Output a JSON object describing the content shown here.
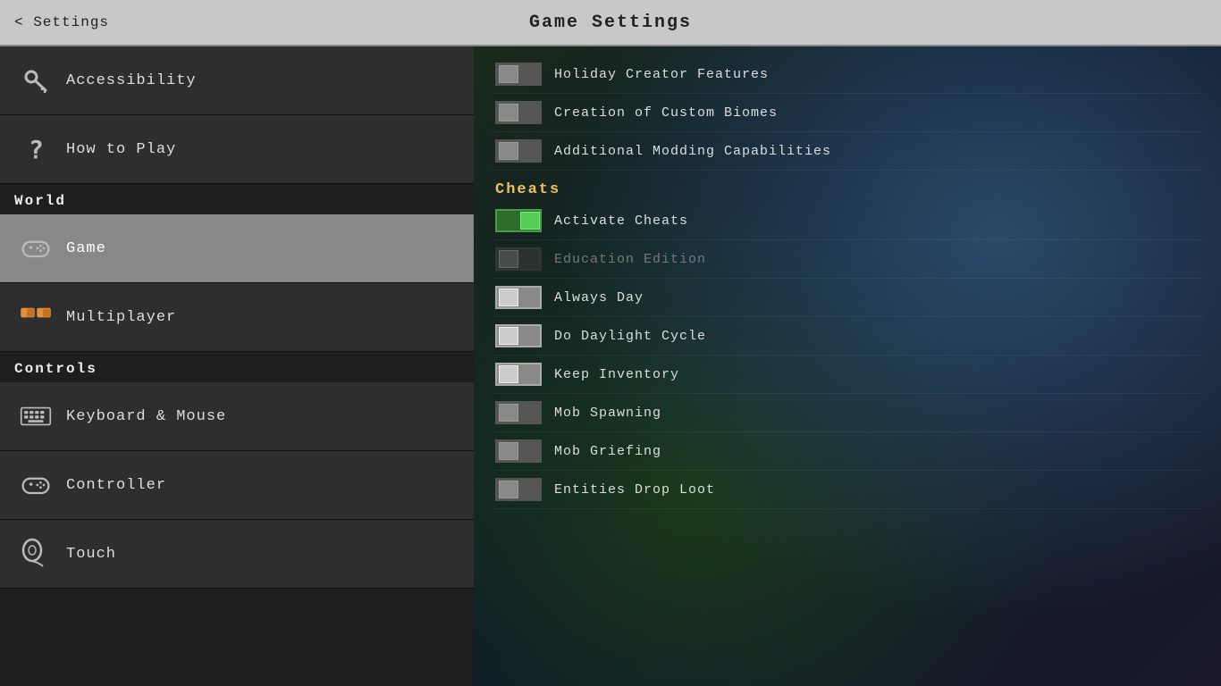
{
  "header": {
    "back_label": "< Settings",
    "title": "Game Settings"
  },
  "sidebar": {
    "items_top": [
      {
        "id": "accessibility",
        "label": "Accessibility",
        "icon": "key",
        "active": false
      },
      {
        "id": "how-to-play",
        "label": "How to Play",
        "icon": "question",
        "active": false
      }
    ],
    "section_world": "World",
    "items_world": [
      {
        "id": "game",
        "label": "Game",
        "icon": "controller",
        "active": true
      },
      {
        "id": "multiplayer",
        "label": "Multiplayer",
        "icon": "players",
        "active": false
      }
    ],
    "section_controls": "Controls",
    "items_controls": [
      {
        "id": "keyboard-mouse",
        "label": "Keyboard & Mouse",
        "icon": "keyboard",
        "active": false
      },
      {
        "id": "controller",
        "label": "Controller",
        "icon": "gamepad",
        "active": false
      },
      {
        "id": "touch",
        "label": "Touch",
        "icon": "touch",
        "active": false
      }
    ]
  },
  "content": {
    "top_settings": [
      {
        "label": "Holiday Creator Features",
        "toggle_state": "off"
      },
      {
        "label": "Creation of Custom Biomes",
        "toggle_state": "off"
      },
      {
        "label": "Additional Modding Capabilities",
        "toggle_state": "off"
      }
    ],
    "cheats_section": "Cheats",
    "cheat_settings": [
      {
        "label": "Activate Cheats",
        "toggle_state": "green-on"
      },
      {
        "label": "Education Edition",
        "toggle_state": "disabled"
      },
      {
        "label": "Always Day",
        "toggle_state": "white-off"
      },
      {
        "label": "Do Daylight Cycle",
        "toggle_state": "white-off"
      },
      {
        "label": "Keep Inventory",
        "toggle_state": "white-off"
      },
      {
        "label": "Mob Spawning",
        "toggle_state": "off"
      },
      {
        "label": "Mob Griefing",
        "toggle_state": "off"
      },
      {
        "label": "Entities Drop Loot",
        "toggle_state": "off"
      }
    ]
  }
}
